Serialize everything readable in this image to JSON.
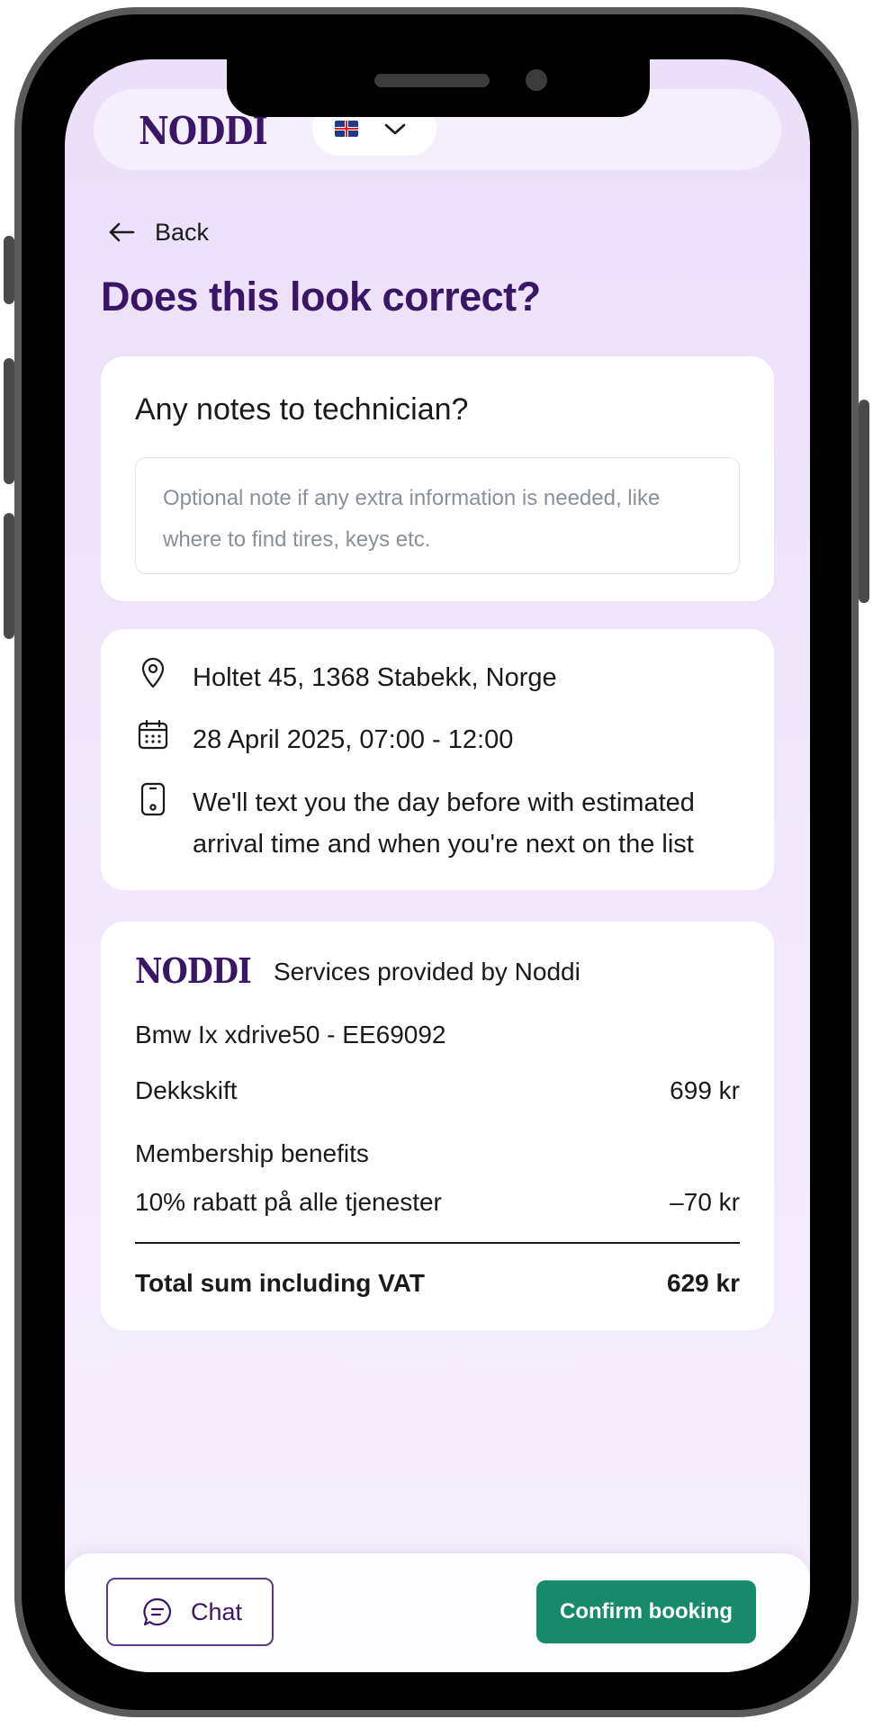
{
  "header": {
    "logo_text": "NODDI",
    "language": {
      "flag": "uk-flag-icon",
      "chevron": "chevron-down-icon"
    }
  },
  "nav": {
    "back_label": "Back",
    "back_icon": "arrow-left-icon"
  },
  "page_title": "Does this look correct?",
  "notes": {
    "heading": "Any notes to technician?",
    "value": "",
    "placeholder": "Optional note if any extra information is needed, like where to find tires, keys etc."
  },
  "booking": {
    "address": {
      "icon": "location-pin-icon",
      "text": "Holtet 45, 1368 Stabekk, Norge"
    },
    "date": {
      "icon": "calendar-icon",
      "text": "28 April 2025, 07:00 - 12:00"
    },
    "sms": {
      "icon": "phone-icon",
      "text": "We'll text you the day before with estimated arrival time and when you're next on the list"
    }
  },
  "summary": {
    "logo_text": "NODDI",
    "provider_text": "Services provided by Noddi",
    "car": "Bmw Ix xdrive50 - EE69092",
    "service": {
      "name": "Dekkskift",
      "price": "699 kr"
    },
    "membership_heading": "Membership benefits",
    "discount": {
      "name": "10% rabatt på alle tjenester",
      "price": "–70 kr"
    },
    "total": {
      "label": "Total sum including VAT",
      "price": "629 kr"
    }
  },
  "footer": {
    "chat_label": "Chat",
    "chat_icon": "chat-bubble-icon",
    "confirm_label": "Confirm booking"
  },
  "colors": {
    "brand_purple": "#3a1766",
    "confirm_green": "#188a6c",
    "background_lavender": "#ebdff9"
  }
}
